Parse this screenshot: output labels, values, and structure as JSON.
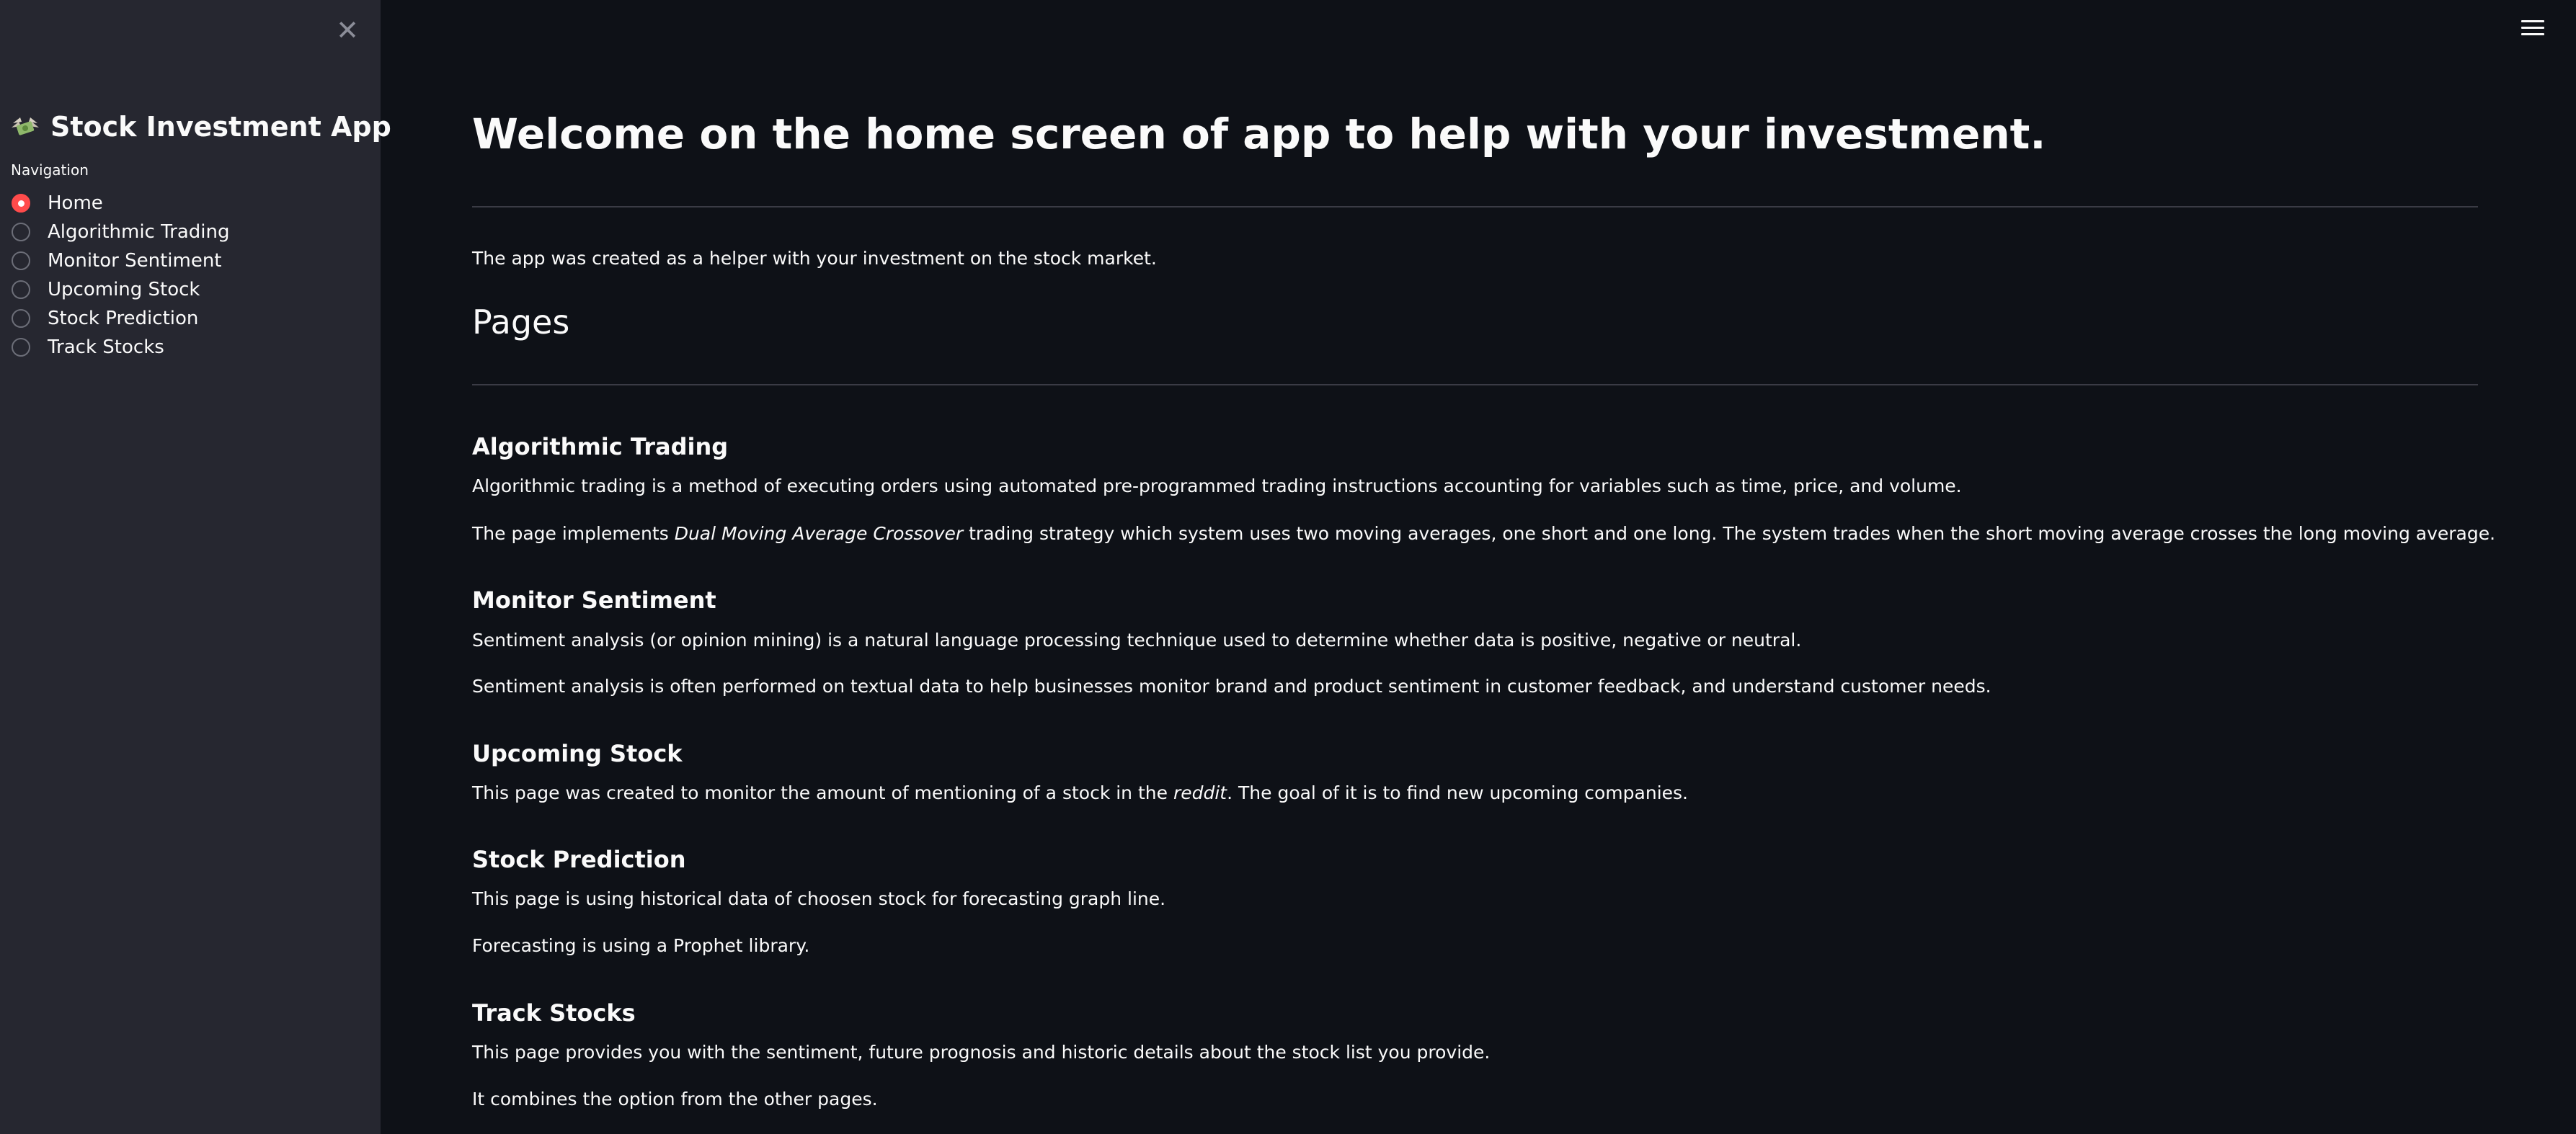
{
  "sidebar": {
    "title": "Stock Investment App",
    "nav_label": "Navigation",
    "items": [
      {
        "label": "Home",
        "selected": true
      },
      {
        "label": "Algorithmic Trading",
        "selected": false
      },
      {
        "label": "Monitor Sentiment",
        "selected": false
      },
      {
        "label": "Upcoming Stock",
        "selected": false
      },
      {
        "label": "Stock Prediction",
        "selected": false
      },
      {
        "label": "Track Stocks",
        "selected": false
      }
    ],
    "close_icon": "close-icon",
    "brand_icon": "money-with-wings-icon"
  },
  "header": {
    "menu_icon": "hamburger-menu-icon"
  },
  "main": {
    "title": "Welcome on the home screen of app to help with your investment.",
    "intro": "The app was created as a helper with your investment on the stock market.",
    "pages_heading": "Pages",
    "sections": {
      "algo": {
        "heading": "Algorithmic Trading",
        "p1": "Algorithmic trading is a method of executing orders using automated pre-programmed trading instructions accounting for variables such as time, price, and volume.",
        "p2_before": "The page implements ",
        "p2_em": "Dual Moving Average Crossover",
        "p2_after": " trading strategy which system uses two moving averages, one short and one long. The system trades when the short moving average crosses the long moving average."
      },
      "sentiment": {
        "heading": "Monitor Sentiment",
        "p1": "Sentiment analysis (or opinion mining) is a natural language processing technique used to determine whether data is positive, negative or neutral.",
        "p2": "Sentiment analysis is often performed on textual data to help businesses monitor brand and product sentiment in customer feedback, and understand customer needs."
      },
      "upcoming": {
        "heading": "Upcoming Stock",
        "p1_before": "This page was created to monitor the amount of mentioning of a stock in the ",
        "p1_em": "reddit",
        "p1_after": ". The goal of it is to find new upcoming companies."
      },
      "prediction": {
        "heading": "Stock Prediction",
        "p1": "This page is using historical data of choosen stock for forecasting graph line.",
        "p2": "Forecasting is using a Prophet library."
      },
      "track": {
        "heading": "Track Stocks",
        "p1": "This page provides you with the sentiment, future prognosis and historic details about the stock list you provide.",
        "p2": "It combines the option from the other pages."
      }
    }
  },
  "colors": {
    "background": "#0e1117",
    "sidebar": "#262730",
    "accent": "#ff4b4b",
    "text": "#fafafa"
  }
}
